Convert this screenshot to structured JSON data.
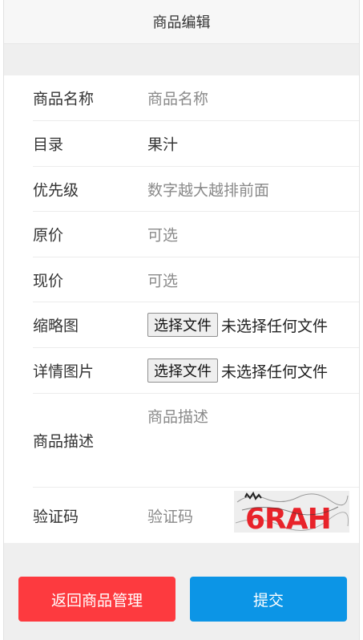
{
  "header": {
    "title": "商品编辑"
  },
  "form": {
    "name": {
      "label": "商品名称",
      "placeholder": "商品名称"
    },
    "category": {
      "label": "目录",
      "value": "果汁"
    },
    "priority": {
      "label": "优先级",
      "placeholder": "数字越大越排前面"
    },
    "original_price": {
      "label": "原价",
      "placeholder": "可选"
    },
    "current_price": {
      "label": "现价",
      "placeholder": "可选"
    },
    "thumbnail": {
      "label": "缩略图",
      "button": "选择文件",
      "status": "未选择任何文件"
    },
    "detail_image": {
      "label": "详情图片",
      "button": "选择文件",
      "status": "未选择任何文件"
    },
    "description": {
      "label": "商品描述",
      "placeholder": "商品描述"
    },
    "captcha": {
      "label": "验证码",
      "placeholder": "验证码",
      "image_text": "6RAH"
    }
  },
  "actions": {
    "back_label": "返回商品管理",
    "submit_label": "提交",
    "back_color": "#fd3a3f",
    "submit_color": "#0c95e6"
  }
}
